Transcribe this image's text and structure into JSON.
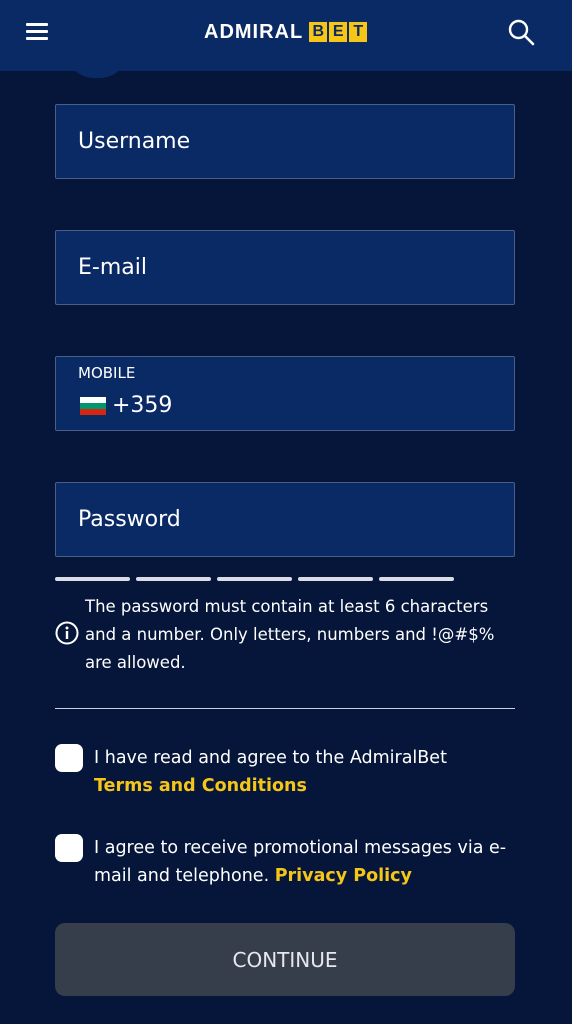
{
  "header": {
    "logo_text": "ADMIRAL",
    "logo_bet_letters": [
      "B",
      "E",
      "T"
    ],
    "accent_color": "#f5c518",
    "icons": {
      "menu": "hamburger-menu-icon",
      "search": "search-icon"
    }
  },
  "form": {
    "username_placeholder": "Username",
    "email_placeholder": "E-mail",
    "mobile_label": "MOBILE",
    "mobile_code": "+359",
    "mobile_flag": "bulgaria-flag-icon",
    "password_placeholder": "Password",
    "password_hint": "The password must contain at least 6 characters and a number. Only letters, numbers and !@#$% are allowed."
  },
  "consents": {
    "terms_text": "I have read and agree to the AdmiralBet",
    "terms_link": "Terms and Conditions",
    "promo_text": "I agree to receive promotional messages via e-mail and telephone.",
    "privacy_link": "Privacy Policy"
  },
  "continue_label": "CONTINUE"
}
